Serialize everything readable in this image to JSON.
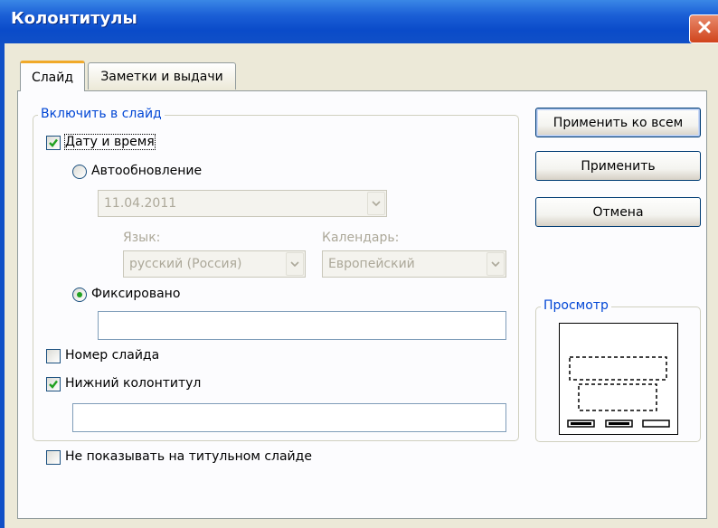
{
  "window": {
    "title": "Колонтитулы",
    "close_icon": "close-icon"
  },
  "tabs": [
    {
      "label": "Слайд",
      "selected": true
    },
    {
      "label": "Заметки и выдачи",
      "selected": false
    }
  ],
  "include_group": {
    "title": "Включить в слайд",
    "date_time": {
      "label": "Дату и время",
      "checked": true
    },
    "auto_update": {
      "label": "Автообновление",
      "selected": false,
      "date_value": "11.04.2011",
      "language_label": "Язык:",
      "language_value": "русский (Россия)",
      "calendar_label": "Календарь:",
      "calendar_value": "Европейский"
    },
    "fixed": {
      "label": "Фиксировано",
      "selected": true,
      "value": ""
    },
    "slide_number": {
      "label": "Номер слайда",
      "checked": false
    },
    "footer": {
      "label": "Нижний колонтитул",
      "checked": true,
      "value": ""
    }
  },
  "dont_show_title": {
    "label": "Не показывать на титульном слайде",
    "checked": false
  },
  "buttons": {
    "apply_all": "Применить ко всем",
    "apply": "Применить",
    "cancel": "Отмена"
  },
  "preview": {
    "title": "Просмотр"
  },
  "colors": {
    "titlebar": "#0a4bc9",
    "check": "#21a121",
    "group_title": "#0046d5",
    "disabled_text": "#aca899",
    "tab_highlight": "#f0a92a"
  }
}
